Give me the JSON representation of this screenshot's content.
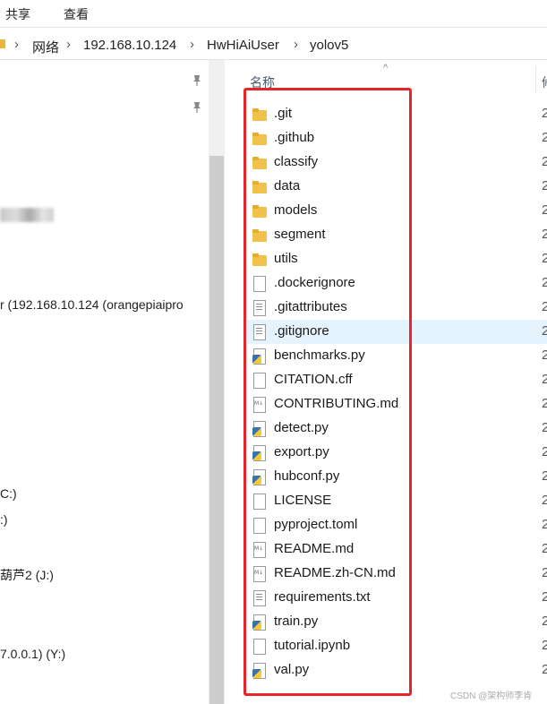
{
  "ribbon": {
    "tabs": [
      "共享",
      "查看"
    ]
  },
  "address": {
    "crumbs": [
      "网络",
      "192.168.10.124",
      "HwHiAiUser",
      "yolov5"
    ]
  },
  "nav": {
    "items": [
      "r (192.168.10.124 (orangepiaipro",
      "C:)",
      ":)",
      "葫芦2 (J:)",
      "7.0.0.1) (Y:)"
    ],
    "blurred_text": "助日文档"
  },
  "file_list": {
    "column_name": "名称",
    "column_second": "修",
    "files": [
      {
        "name": ".git",
        "type": "folder"
      },
      {
        "name": ".github",
        "type": "folder"
      },
      {
        "name": "classify",
        "type": "folder"
      },
      {
        "name": "data",
        "type": "folder"
      },
      {
        "name": "models",
        "type": "folder"
      },
      {
        "name": "segment",
        "type": "folder"
      },
      {
        "name": "utils",
        "type": "folder"
      },
      {
        "name": ".dockerignore",
        "type": "file"
      },
      {
        "name": ".gitattributes",
        "type": "text"
      },
      {
        "name": ".gitignore",
        "type": "text",
        "selected": true
      },
      {
        "name": "benchmarks.py",
        "type": "py"
      },
      {
        "name": "CITATION.cff",
        "type": "file"
      },
      {
        "name": "CONTRIBUTING.md",
        "type": "md"
      },
      {
        "name": "detect.py",
        "type": "py"
      },
      {
        "name": "export.py",
        "type": "py"
      },
      {
        "name": "hubconf.py",
        "type": "py"
      },
      {
        "name": "LICENSE",
        "type": "file"
      },
      {
        "name": "pyproject.toml",
        "type": "file"
      },
      {
        "name": "README.md",
        "type": "md"
      },
      {
        "name": "README.zh-CN.md",
        "type": "md"
      },
      {
        "name": "requirements.txt",
        "type": "text"
      },
      {
        "name": "train.py",
        "type": "py"
      },
      {
        "name": "tutorial.ipynb",
        "type": "file"
      },
      {
        "name": "val.py",
        "type": "py"
      }
    ],
    "date_prefix": "2"
  },
  "watermark": "CSDN @架构师李肯",
  "colors": {
    "highlight": "#e8262a",
    "selected_row": "#e5f3ff",
    "folder": "#f0c24b"
  }
}
